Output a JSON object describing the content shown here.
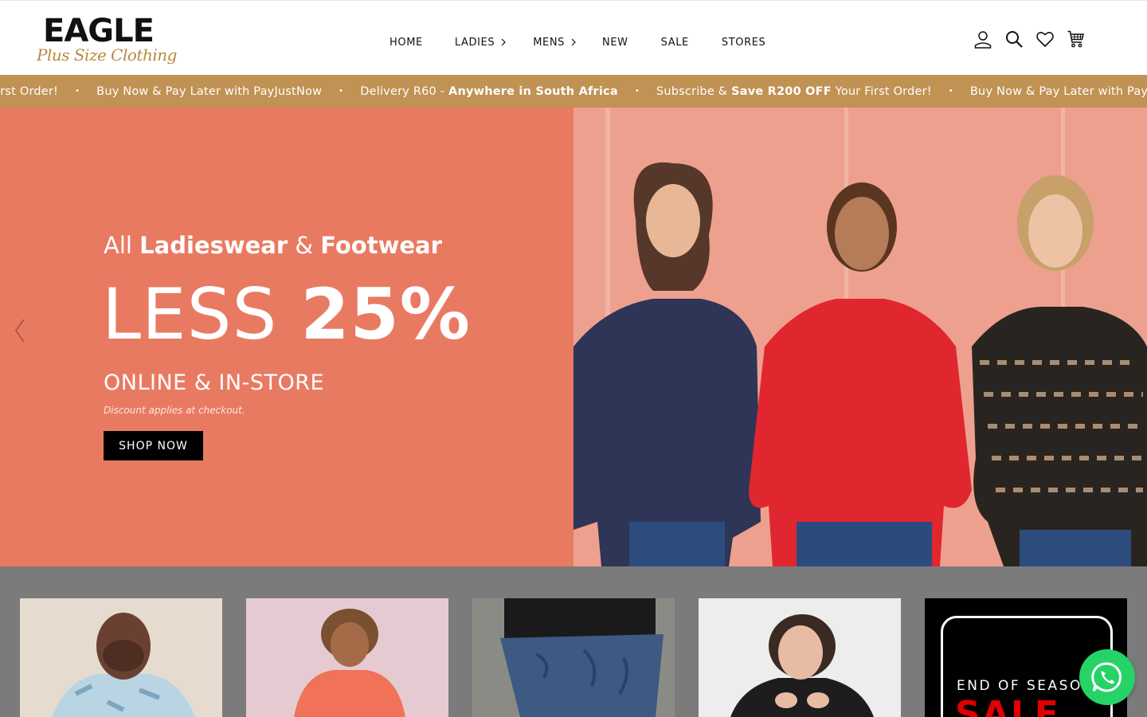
{
  "brand": {
    "name": "EAGLE",
    "tagline": "Plus Size Clothing"
  },
  "nav": {
    "items": [
      {
        "label": "HOME"
      },
      {
        "label": "LADIES",
        "has_submenu": true
      },
      {
        "label": "MENS",
        "has_submenu": true
      },
      {
        "label": "NEW"
      },
      {
        "label": "SALE"
      },
      {
        "label": "STORES"
      }
    ]
  },
  "header_icons": [
    "user-icon",
    "search-icon",
    "heart-icon",
    "cart-icon"
  ],
  "announcements": {
    "m0": {
      "text": "irst Order!"
    },
    "m1": {
      "text": "Buy Now & Pay Later with PayJustNow"
    },
    "m2": {
      "pre": "Delivery R60 - ",
      "bold": "Anywhere in South Africa"
    },
    "m3": {
      "pre": "Subscribe & ",
      "bold": "Save R200 OFF",
      "post": " Your First Order!"
    },
    "m4": {
      "text": "Buy Now & Pay Later with PayJustNow"
    },
    "separator": "•"
  },
  "hero": {
    "line1": {
      "a": "All ",
      "b": "Ladieswear",
      "c": " & ",
      "d": "Footwear"
    },
    "line2": {
      "a": "LESS ",
      "b": "25%"
    },
    "line3": "ONLINE & IN-STORE",
    "note": "Discount applies at checkout.",
    "cta": "SHOP NOW",
    "bg_color": "#e97a62"
  },
  "categories": {
    "sale_card": {
      "line1": "END OF SEASO",
      "line2": "SALE"
    }
  },
  "colors": {
    "announce_bg": "#c09253",
    "hero_left": "#e97a62",
    "whatsapp": "#25d366"
  }
}
